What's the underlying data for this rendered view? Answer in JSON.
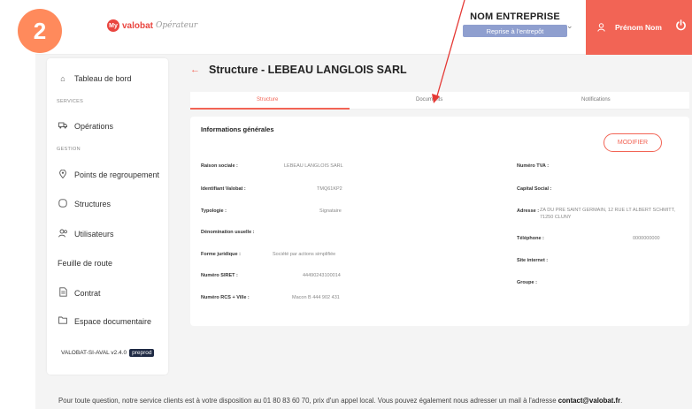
{
  "step_badge": "2",
  "logo": {
    "badge": "My",
    "brand": "valobat",
    "subtitle": "Opérateur"
  },
  "header": {
    "company_name": "NOM ENTREPRISE",
    "resume_button": "Reprise à l'entrepôt",
    "user_name": "Prénom Nom"
  },
  "sidebar": {
    "dashboard": "Tableau de bord",
    "section_services": "SERVICES",
    "operations": "Opérations",
    "section_gestion": "GESTION",
    "points": "Points de regroupement",
    "structures": "Structures",
    "users": "Utilisateurs",
    "roadmap": "Feuille de route",
    "contract": "Contrat",
    "docs_space": "Espace documentaire",
    "version": "VALOBAT-SI-AVAL v2.4.0",
    "env": "preprod"
  },
  "main": {
    "title": "Structure - LEBEAU LANGLOIS SARL",
    "tabs": [
      "Structure",
      "Documents",
      "Notifications"
    ],
    "card_title": "Informations générales",
    "modify_button": "MODIFIER",
    "left_fields": [
      {
        "label": "Raison sociale :",
        "value": "LEBEAU LANGLOIS SARL"
      },
      {
        "label": "Identifiant Valobat :",
        "value": "TMQ61KP2"
      },
      {
        "label": "Typologie :",
        "value": "Signataire"
      },
      {
        "label": "Dénomination usuelle :",
        "value": ""
      },
      {
        "label": "Forme juridique :",
        "value": "Société par actions simplifiée"
      },
      {
        "label": "Numéro SIRET :",
        "value": "44490243100014"
      },
      {
        "label": "Numéro RCS + Ville :",
        "value": "Macon B 444 902 431"
      }
    ],
    "right_fields": [
      {
        "label": "Numéro TVA :",
        "value": ""
      },
      {
        "label": "Capital Social :",
        "value": ""
      },
      {
        "label": "Adresse :",
        "value": "ZA DU PRE SAINT GERMAIN, 12 RUE LT ALBERT SCHMITT, 71250 CLUNY"
      },
      {
        "label": "Téléphone :",
        "value": "0000000000"
      },
      {
        "label": "Site internet :",
        "value": ""
      },
      {
        "label": "Groupe :",
        "value": ""
      }
    ]
  },
  "footer": {
    "text": "Pour toute question, notre service clients est à votre disposition au 01 80 83 60 70, prix d'un appel local. Vous pouvez également nous adresser un mail à l'adresse ",
    "email": "contact@valobat.fr",
    "tail": "."
  },
  "colors": {
    "accent": "#f26455",
    "badge": "#ff8a5c",
    "resume": "#8f9fcf",
    "env": "#1f2a44"
  }
}
